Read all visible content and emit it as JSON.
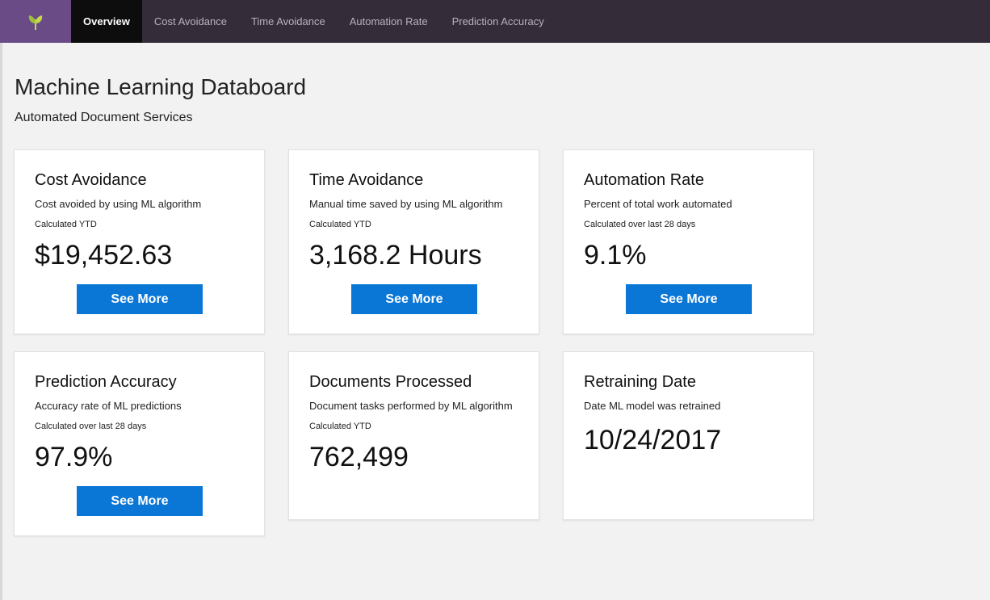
{
  "nav": {
    "items": [
      {
        "label": "Overview",
        "active": true
      },
      {
        "label": "Cost Avoidance",
        "active": false
      },
      {
        "label": "Time Avoidance",
        "active": false
      },
      {
        "label": "Automation Rate",
        "active": false
      },
      {
        "label": "Prediction Accuracy",
        "active": false
      }
    ],
    "logo_icon": "leaf-sprout-icon"
  },
  "page": {
    "title": "Machine Learning Databoard",
    "subtitle": "Automated Document Services"
  },
  "cards": [
    {
      "title": "Cost Avoidance",
      "description": "Cost avoided by using ML algorithm",
      "period": "Calculated YTD",
      "value": "$19,452.63",
      "button": "See More"
    },
    {
      "title": "Time Avoidance",
      "description": "Manual time saved by using ML algorithm",
      "period": "Calculated YTD",
      "value": "3,168.2 Hours",
      "button": "See More"
    },
    {
      "title": "Automation Rate",
      "description": "Percent of total work automated",
      "period": "Calculated over last 28 days",
      "value": "9.1%",
      "button": "See More"
    },
    {
      "title": "Prediction Accuracy",
      "description": "Accuracy rate of ML predictions",
      "period": "Calculated over last 28 days",
      "value": "97.9%",
      "button": "See More"
    },
    {
      "title": "Documents Processed",
      "description": "Document tasks performed by ML algorithm",
      "period": "Calculated YTD",
      "value": "762,499"
    },
    {
      "title": "Retraining Date",
      "description": "Date ML model was retrained",
      "value": "10/24/2017"
    }
  ],
  "colors": {
    "navbar": "#342c39",
    "logo_bg": "#6a4b86",
    "active_tab": "#0d0d0d",
    "button": "#0a76d6",
    "background": "#f2f2f2"
  }
}
